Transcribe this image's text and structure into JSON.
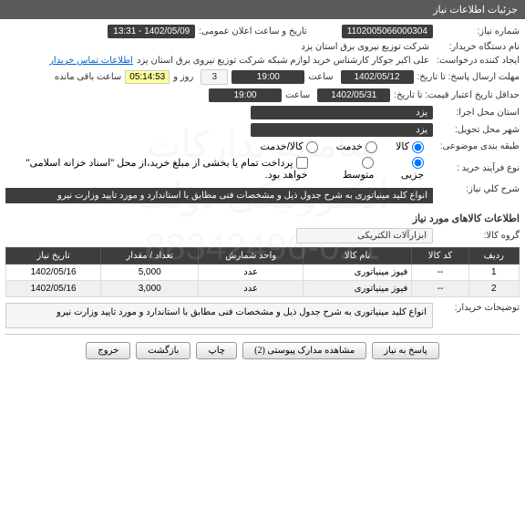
{
  "header": {
    "title": "جزئیات اطلاعات نیاز"
  },
  "fields": {
    "needNo": {
      "label": "شماره نیاز:",
      "value": "1102005066000304"
    },
    "announce": {
      "label": "تاریخ و ساعت اعلان عمومی:",
      "value": "1402/05/09 - 13:31"
    },
    "buyer": {
      "label": "نام دستگاه خریدار:",
      "value": "شرکت توزیع نیروی برق استان یزد"
    },
    "requester": {
      "label": "ایجاد کننده درخواست:",
      "value": "علی اکبر جوکار  کارشناس خرید لوازم شبکه  شرکت توزیع نیروی برق استان یزد",
      "link": "اطلاعات تماس خریدار"
    },
    "deadline": {
      "label": "مهلت ارسال پاسخ: تا تاریخ:",
      "date": "1402/05/12",
      "timeLabel": "ساعت",
      "time": "19:00",
      "daysVal": "3",
      "daysLabel": "روز و",
      "remain": "05:14:53",
      "remainLabel": "ساعت باقی مانده"
    },
    "validity": {
      "label": "حداقل تاریخ اعتبار قیمت: تا تاریخ:",
      "date": "1402/05/31",
      "timeLabel": "ساعت",
      "time": "19:00"
    },
    "execLoc": {
      "label": "استان محل اجرا:",
      "value": "یزد"
    },
    "deliverLoc": {
      "label": "شهر محل تحویل:",
      "value": "یزد"
    },
    "category": {
      "label": "طبقه بندی موضوعی:",
      "opts": [
        "کالا",
        "خدمت",
        "کالا/خدمت"
      ],
      "sel": 0
    },
    "buyType": {
      "label": "نوع فرآیند خرید :",
      "opts": [
        "جزیی",
        "متوسط"
      ],
      "sel": 0,
      "note": "پرداخت تمام یا بخشی از مبلغ خرید،از محل \"اسناد خزانه اسلامی\" خواهد بود."
    },
    "needDesc": {
      "label": "شرح کلي نياز:",
      "value": "انواع کلید مینیاتوری  به شرح جدول ذیل و مشخصات فنی مطابق با استاندارد و مورد تایید وزارت نیرو"
    },
    "group": {
      "label": "گروه کالا:",
      "value": "ابزارآلات الکتریکی"
    },
    "buyerNote": {
      "label": "توضیحات خریدار:",
      "value": "انواع کلید مینیاتوری  به شرح جدول ذیل و مشخصات فنی مطابق با استاندارد و مورد تایید وزارت نیرو"
    }
  },
  "sections": {
    "items": "اطلاعات کالاهای مورد نیاز"
  },
  "table": {
    "headers": [
      "ردیف",
      "کد کالا",
      "نام کالا",
      "واحد شمارش",
      "تعداد / مقدار",
      "تاریخ نیاز"
    ],
    "rows": [
      [
        "1",
        "--",
        "فیوز مینیاتوری",
        "عدد",
        "5,000",
        "1402/05/16"
      ],
      [
        "2",
        "--",
        "فیوز مینیاتوری",
        "عدد",
        "3,000",
        "1402/05/16"
      ]
    ]
  },
  "buttons": {
    "respond": "پاسخ به نیاز",
    "attach": "مشاهده مدارک پیوستی (2)",
    "print": "چاپ",
    "back": "بازگشت",
    "exit": "خروج"
  },
  "watermark": "سامانه تدارکات الکترونیکی دولت\n021-88342496"
}
